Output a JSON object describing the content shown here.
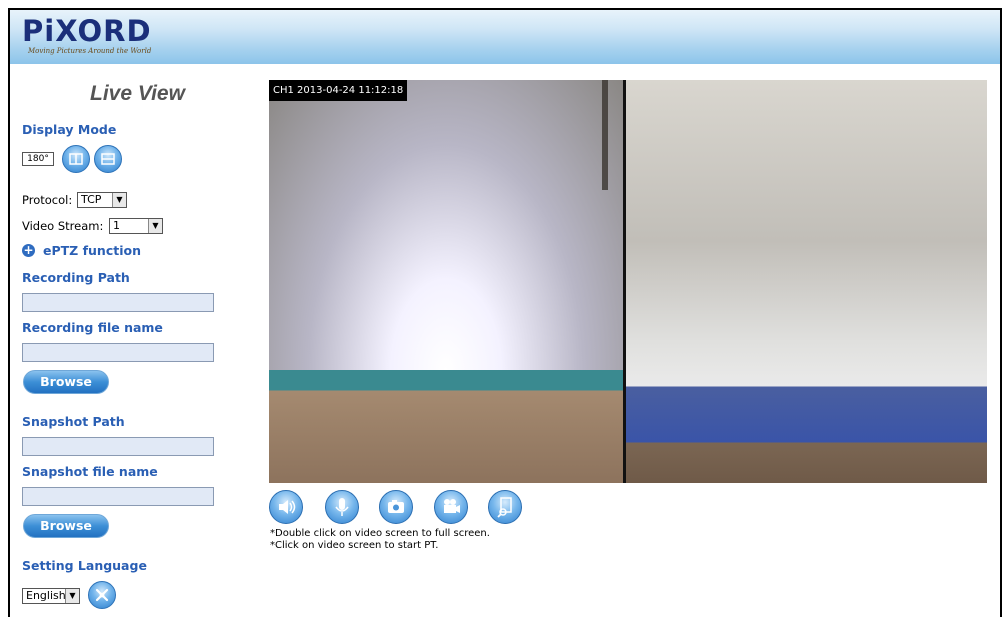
{
  "header": {
    "logo_text": "PiXORD",
    "tagline": "Moving Pictures Around the World"
  },
  "sidebar": {
    "title": "Live View",
    "display_mode_label": "Display Mode",
    "mode_180_label": "180°",
    "protocol_label": "Protocol:",
    "protocol_value": "TCP",
    "video_stream_label": "Video Stream:",
    "video_stream_value": "1",
    "eptz_label": "ePTZ function",
    "recording_path_label": "Recording Path",
    "recording_path_value": "",
    "recording_file_label": "Recording file name",
    "recording_file_value": "",
    "browse_label": "Browse",
    "snapshot_path_label": "Snapshot Path",
    "snapshot_path_value": "",
    "snapshot_file_label": "Snapshot file name",
    "snapshot_file_value": "",
    "browse2_label": "Browse",
    "language_label": "Setting Language",
    "language_value": "English"
  },
  "video": {
    "osd_text": "CH1 2013-04-24 11:12:18"
  },
  "controls": [
    {
      "name": "speaker-icon"
    },
    {
      "name": "microphone-icon"
    },
    {
      "name": "snapshot-camera-icon"
    },
    {
      "name": "record-video-camera-icon"
    },
    {
      "name": "playback-file-icon"
    }
  ],
  "hints": {
    "line1": "*Double click on video screen to full screen.",
    "line2": "*Click on video screen to start PT."
  },
  "colors": {
    "accent": "#2a5fb4",
    "header_top": "#e8f3fb",
    "header_bottom": "#8cc4ea"
  }
}
